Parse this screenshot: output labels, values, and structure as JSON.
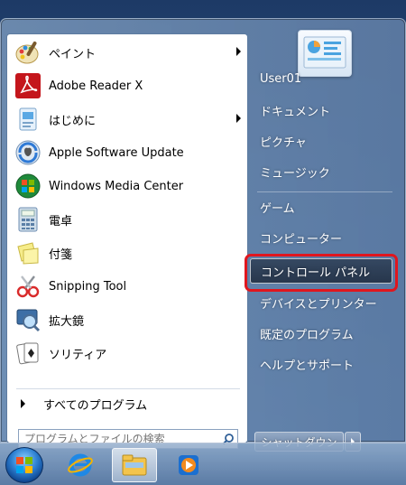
{
  "programs": [
    {
      "label": "ペイント",
      "icon": "paint-icon",
      "submenu": true
    },
    {
      "label": "Adobe Reader X",
      "icon": "adobe-reader-icon",
      "submenu": false
    },
    {
      "label": "はじめに",
      "icon": "getting-started-icon",
      "submenu": true
    },
    {
      "label": "Apple Software Update",
      "icon": "apple-update-icon",
      "submenu": false
    },
    {
      "label": "Windows Media Center",
      "icon": "media-center-icon",
      "submenu": false
    },
    {
      "label": "電卓",
      "icon": "calculator-icon",
      "submenu": false
    },
    {
      "label": "付箋",
      "icon": "sticky-notes-icon",
      "submenu": false
    },
    {
      "label": "Snipping Tool",
      "icon": "snipping-tool-icon",
      "submenu": false
    },
    {
      "label": "拡大鏡",
      "icon": "magnifier-icon",
      "submenu": false
    },
    {
      "label": "ソリティア",
      "icon": "solitaire-icon",
      "submenu": false
    }
  ],
  "all_programs_label": "すべてのプログラム",
  "search": {
    "placeholder": "プログラムとファイルの検索"
  },
  "right_items": [
    {
      "label": "User01",
      "name": "user-folder"
    },
    {
      "label": "ドキュメント",
      "name": "documents"
    },
    {
      "label": "ピクチャ",
      "name": "pictures"
    },
    {
      "label": "ミュージック",
      "name": "music"
    },
    {
      "label": "ゲーム",
      "name": "games"
    },
    {
      "label": "コンピューター",
      "name": "computer"
    },
    {
      "label": "コントロール パネル",
      "name": "control-panel",
      "highlighted": true
    },
    {
      "label": "デバイスとプリンター",
      "name": "devices-printers"
    },
    {
      "label": "既定のプログラム",
      "name": "default-programs"
    },
    {
      "label": "ヘルプとサポート",
      "name": "help-support"
    }
  ],
  "shutdown_label": "シャットダウン",
  "colors": {
    "highlight_frame": "#e0161e"
  },
  "taskbar": [
    "windows-start-orb",
    "internet-explorer-icon",
    "file-explorer-icon",
    "media-player-icon"
  ]
}
